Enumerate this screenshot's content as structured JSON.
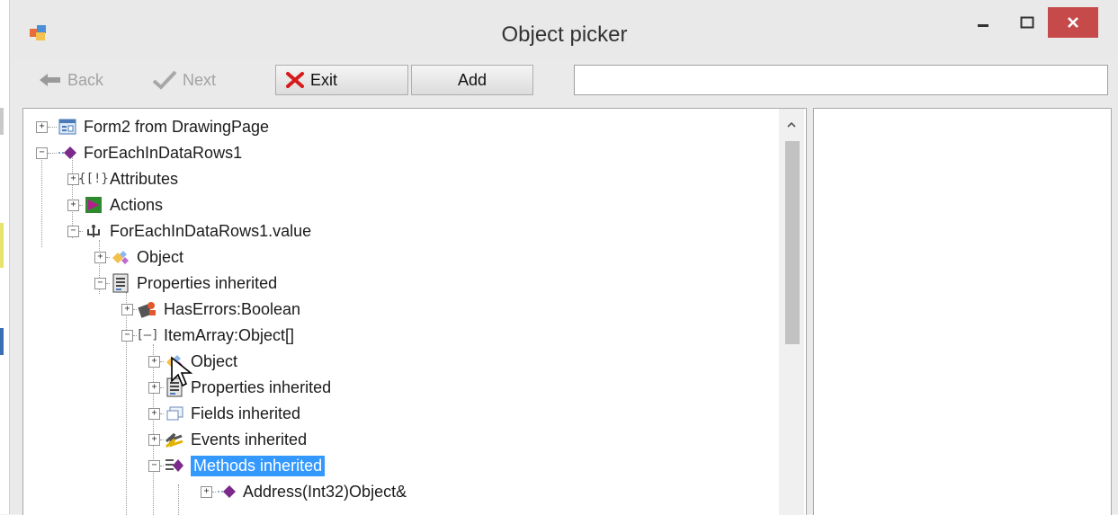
{
  "window": {
    "title": "Object picker",
    "app_icon": "app-window-icon",
    "controls": {
      "minimize": "minimize-icon",
      "maximize": "maximize-icon",
      "close": "close-icon"
    }
  },
  "toolbar": {
    "back_label": "Back",
    "next_label": "Next",
    "exit_label": "Exit",
    "add_label": "Add",
    "search_value": ""
  },
  "colors": {
    "selection": "#3399ff",
    "close_button": "#c74a4a",
    "exit_icon": "#d71a1a"
  },
  "tree": {
    "items": [
      {
        "label": "Form2 from DrawingPage",
        "icon": "form-icon",
        "expanded": false
      },
      {
        "label": "ForEachInDataRows1",
        "icon": "node-icon",
        "expanded": true
      },
      {
        "label": "Attributes",
        "icon": "attributes-icon",
        "expanded": false
      },
      {
        "label": "Actions",
        "icon": "actions-icon",
        "expanded": false
      },
      {
        "label": "ForEachInDataRows1.value",
        "icon": "value-icon",
        "expanded": true
      },
      {
        "label": "Object",
        "icon": "object-icon",
        "expanded": false
      },
      {
        "label": "Properties inherited",
        "icon": "properties-icon",
        "expanded": true
      },
      {
        "label": "HasErrors:Boolean",
        "icon": "boolean-property-icon",
        "expanded": false
      },
      {
        "label": "ItemArray:Object[]",
        "icon": "array-icon",
        "expanded": true
      },
      {
        "label": "Object",
        "icon": "object-icon",
        "expanded": false
      },
      {
        "label": "Properties inherited",
        "icon": "properties-icon",
        "expanded": false
      },
      {
        "label": "Fields inherited",
        "icon": "fields-icon",
        "expanded": false
      },
      {
        "label": "Events inherited",
        "icon": "events-icon",
        "expanded": false
      },
      {
        "label": "Methods inherited",
        "icon": "methods-icon",
        "expanded": true,
        "selected": true
      },
      {
        "label": "Address(Int32)Object&",
        "icon": "method-icon",
        "expanded": false
      }
    ]
  }
}
